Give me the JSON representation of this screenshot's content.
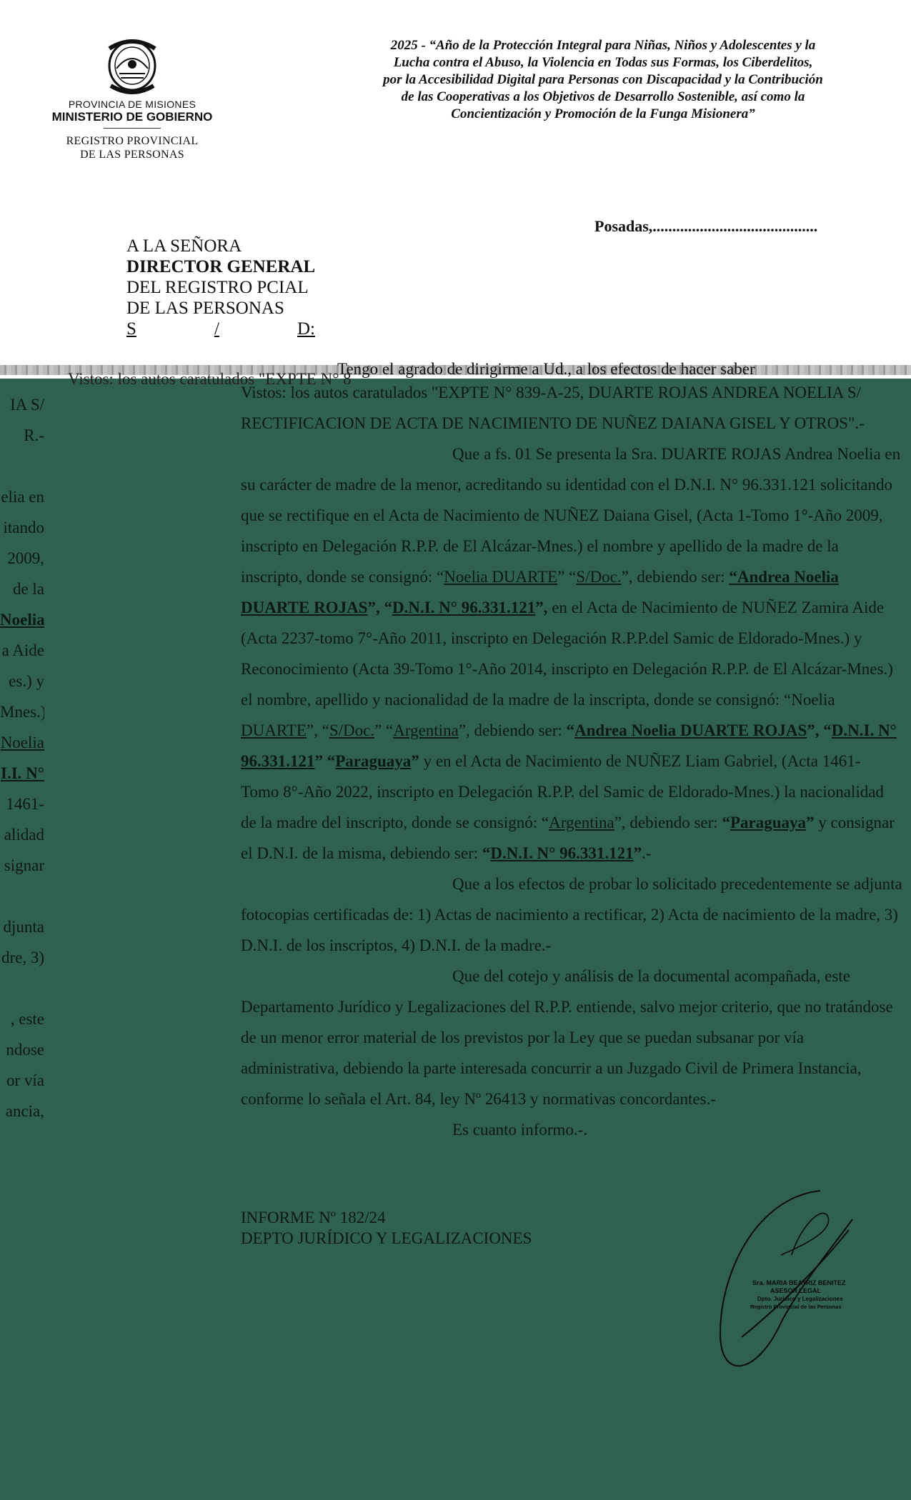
{
  "header": {
    "ministry_line1": "PROVINCIA DE MISIONES",
    "ministry_line2": "MINISTERIO DE GOBIERNO",
    "registry_line1": "REGISTRO PROVINCIAL",
    "registry_line2": "DE LAS PERSONAS",
    "seal_text": "PROVINCIA DE MISIONES",
    "motto": [
      "2025 - “Año de la Protección Integral para Niñas, Niños y Adolescentes y la",
      "Lucha contra el Abuso, la Violencia en Todas sus Formas, los Ciberdelitos,",
      "por la Accesibilidad Digital para Personas con Discapacidad y la Contribución",
      "de las Cooperativas a los Objetivos de Desarrollo Sostenible, así como la",
      "Concientización y Promoción de la Funga Misionera”"
    ]
  },
  "place_date": "Posadas,..........................................",
  "addressee": {
    "line1": "A LA SEÑORA",
    "line2": "DIRECTOR GENERAL",
    "line3": "DEL REGISTRO PCIAL",
    "line4": "DE LAS PERSONAS",
    "s": "S",
    "slash": "/",
    "d": "D:"
  },
  "greeting_line": "Tengo el agrado de dirigirme a Ud., a los efectos de hacer saber",
  "ghost_visto": "Vistos: los autos caratulados \"EXPTE N° 8",
  "left_column": [
    "IA S/",
    "R.-",
    "",
    "elia en",
    "itando",
    "2009,",
    "de la",
    "Noelia",
    "a Aide",
    "es.) y",
    "Mnes.)",
    "Noelia",
    "I.I. N°",
    "1461-",
    "alidad",
    "signar",
    "",
    "djunta",
    "dre, 3)",
    "",
    ", este",
    "ndose",
    "or vía",
    "ancia,"
  ],
  "body": {
    "p1_line1": "Vistos: los autos caratulados \"EXPTE N° 839-A-25, DUARTE ROJAS ANDREA NOELIA S/",
    "p1_line2": "RECTIFICACION DE ACTA DE NACIMIENTO DE NUÑEZ DAIANA GISEL Y OTROS\".-",
    "p2_line1": "Que a fs. 01 Se presenta la Sra. DUARTE ROJAS Andrea Noelia en",
    "p2_line2": "su carácter de madre de la menor, acreditando su identidad con el D.N.I. N° 96.331.121 solicitando",
    "p2_line3": "que se rectifique en el Acta de Nacimiento de NUÑEZ Daiana Gisel, (Acta 1-Tomo 1°-Año 2009,",
    "p2_line4": "inscripto en Delegación R.P.P. de El Alcázar-Mnes.) el nombre y apellido de la madre de la",
    "p2_line5_a": "inscripto, donde se consignó: “",
    "p2_line5_b": "Noelia DUARTE",
    "p2_line5_c": "” “",
    "p2_line5_d": "S/Doc.",
    "p2_line5_e": "”, debiendo ser: ",
    "p2_line5_f": "“Andrea Noelia",
    "p2_line6_a": "DUARTE ROJAS",
    "p2_line6_b": "”, “",
    "p2_line6_c": "D.N.I. N° 96.331.121",
    "p2_line6_d": "”,",
    "p2_line6_e": " en el Acta de Nacimiento de NUÑEZ Zamira Aide",
    "p2_line7": "(Acta 2237-tomo 7°-Año 2011, inscripto en Delegación R.P.P.del Samic de Eldorado-Mnes.) y",
    "p2_line8": "Reconocimiento (Acta 39-Tomo 1°-Año 2014, inscripto en Delegación R.P.P. de El Alcázar-Mnes.)",
    "p2_line9": "el nombre, apellido y nacionalidad de la madre de la inscripta, donde se consignó: “Noelia",
    "p2_line10_a": "DUARTE",
    "p2_line10_b": "”, “",
    "p2_line10_c": "S/Doc.",
    "p2_line10_d": "” “",
    "p2_line10_e": "Argentina",
    "p2_line10_f": "”, debiendo ser: ",
    "p2_line10_g": "“",
    "p2_line10_h": "Andrea Noelia DUARTE ROJAS",
    "p2_line10_i": "”, “",
    "p2_line10_j": "D.N.I. N°",
    "p2_line11_a": "96.331.121",
    "p2_line11_b": "” “",
    "p2_line11_c": "Paraguaya",
    "p2_line11_d": "”",
    "p2_line11_e": " y en el Acta de Nacimiento de NUÑEZ Liam Gabriel, (Acta 1461-",
    "p2_line12": "Tomo 8°-Año 2022, inscripto en Delegación R.P.P. del Samic de Eldorado-Mnes.) la nacionalidad",
    "p2_line13_a": "de la madre del inscripto, donde se consignó: “",
    "p2_line13_b": "Argentina",
    "p2_line13_c": "”, debiendo ser: ",
    "p2_line13_d": "“",
    "p2_line13_e": "Paraguaya",
    "p2_line13_f": "”",
    "p2_line13_g": " y consignar",
    "p2_line14_a": "el D.N.I. de la misma, debiendo ser: ",
    "p2_line14_b": "“",
    "p2_line14_c": "D.N.I. N° 96.331.121",
    "p2_line14_d": "”",
    "p2_line14_e": ".-",
    "p3_line1": "Que a los efectos de probar lo solicitado precedentemente se adjunta",
    "p3_line2": "fotocopias certificadas de: 1) Actas de nacimiento a rectificar, 2) Acta de nacimiento de la madre, 3)",
    "p3_line3": "D.N.I. de los inscriptos, 4) D.N.I. de la madre.-",
    "p4_line1": "Que del cotejo y análisis de la documental acompañada, este",
    "p4_line2": "Departamento Jurídico y Legalizaciones del R.P.P. entiende, salvo mejor criterio, que no tratándose",
    "p4_line3": "de un menor error material de los previstos por la Ley que se puedan subsanar por vía",
    "p4_line4": "administrativa, debiendo la parte interesada concurrir a un Juzgado Civil de Primera Instancia,",
    "p4_line5": "conforme lo señala el Art. 84, ley Nº 26413 y normativas concordantes.-",
    "closing": "Es cuanto informo.-."
  },
  "report": {
    "number": "INFORME Nº 182/24",
    "department": "DEPTO JURÍDICO Y LEGALIZACIONES"
  },
  "signature_stamp": {
    "line1": "Sra. MARIA BEATRIZ BENITEZ",
    "line2": "ASESOR LEGAL",
    "line3": "Dpto. Jurídico y Legalizaciones",
    "line4": "Registro Provincial de las Personas"
  },
  "colors": {
    "overlay_green": "#2f6050",
    "text": "#0c1a14"
  }
}
